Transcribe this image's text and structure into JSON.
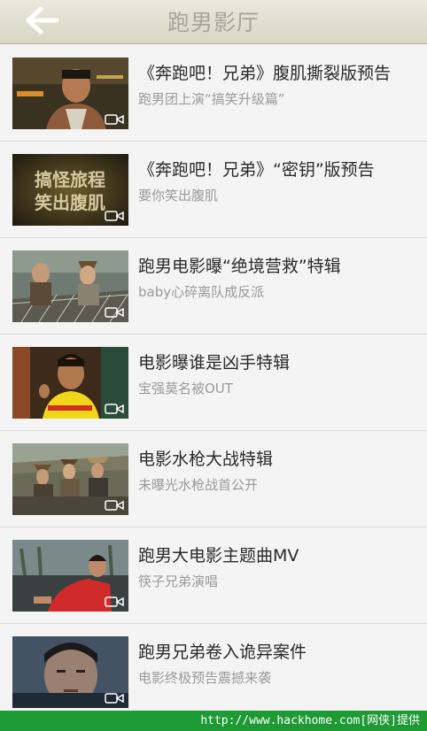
{
  "header": {
    "title": "跑男影厅",
    "back_icon": "arrow-left-icon"
  },
  "items": [
    {
      "title": "《奔跑吧！兄弟》腹肌撕裂版预告",
      "subtitle": "跑男团上演“搞笑升级篇”",
      "badge_icon": "video-camera-icon"
    },
    {
      "title": "《奔跑吧！兄弟》“密钥”版预告",
      "subtitle": "要你笑出腹肌",
      "badge_icon": "video-camera-icon",
      "thumb_text": [
        "搞怪旅程",
        "笑出腹肌"
      ]
    },
    {
      "title": "跑男电影曝“绝境营救”特辑",
      "subtitle": "baby心碎离队成反派",
      "badge_icon": "video-camera-icon"
    },
    {
      "title": "电影曝谁是凶手特辑",
      "subtitle": "宝强莫名被OUT",
      "badge_icon": "video-camera-icon"
    },
    {
      "title": "电影水枪大战特辑",
      "subtitle": "未曝光水枪战首公开",
      "badge_icon": "video-camera-icon"
    },
    {
      "title": "跑男大电影主题曲MV",
      "subtitle": "筷子兄弟演唱",
      "badge_icon": "video-camera-icon"
    },
    {
      "title": "跑男兄弟卷入诡异案件",
      "subtitle": "电影终极预告震撼来袭",
      "badge_icon": "video-camera-icon"
    }
  ],
  "watermark": "http://www.hackhome.com[网侠]提供",
  "colors": {
    "header_bg": "#dcdcca",
    "title_text": "#a5a59a",
    "item_title": "#2a2a2a",
    "item_subtitle": "#9a9a9a",
    "watermark_bg": "#1e9a34"
  }
}
